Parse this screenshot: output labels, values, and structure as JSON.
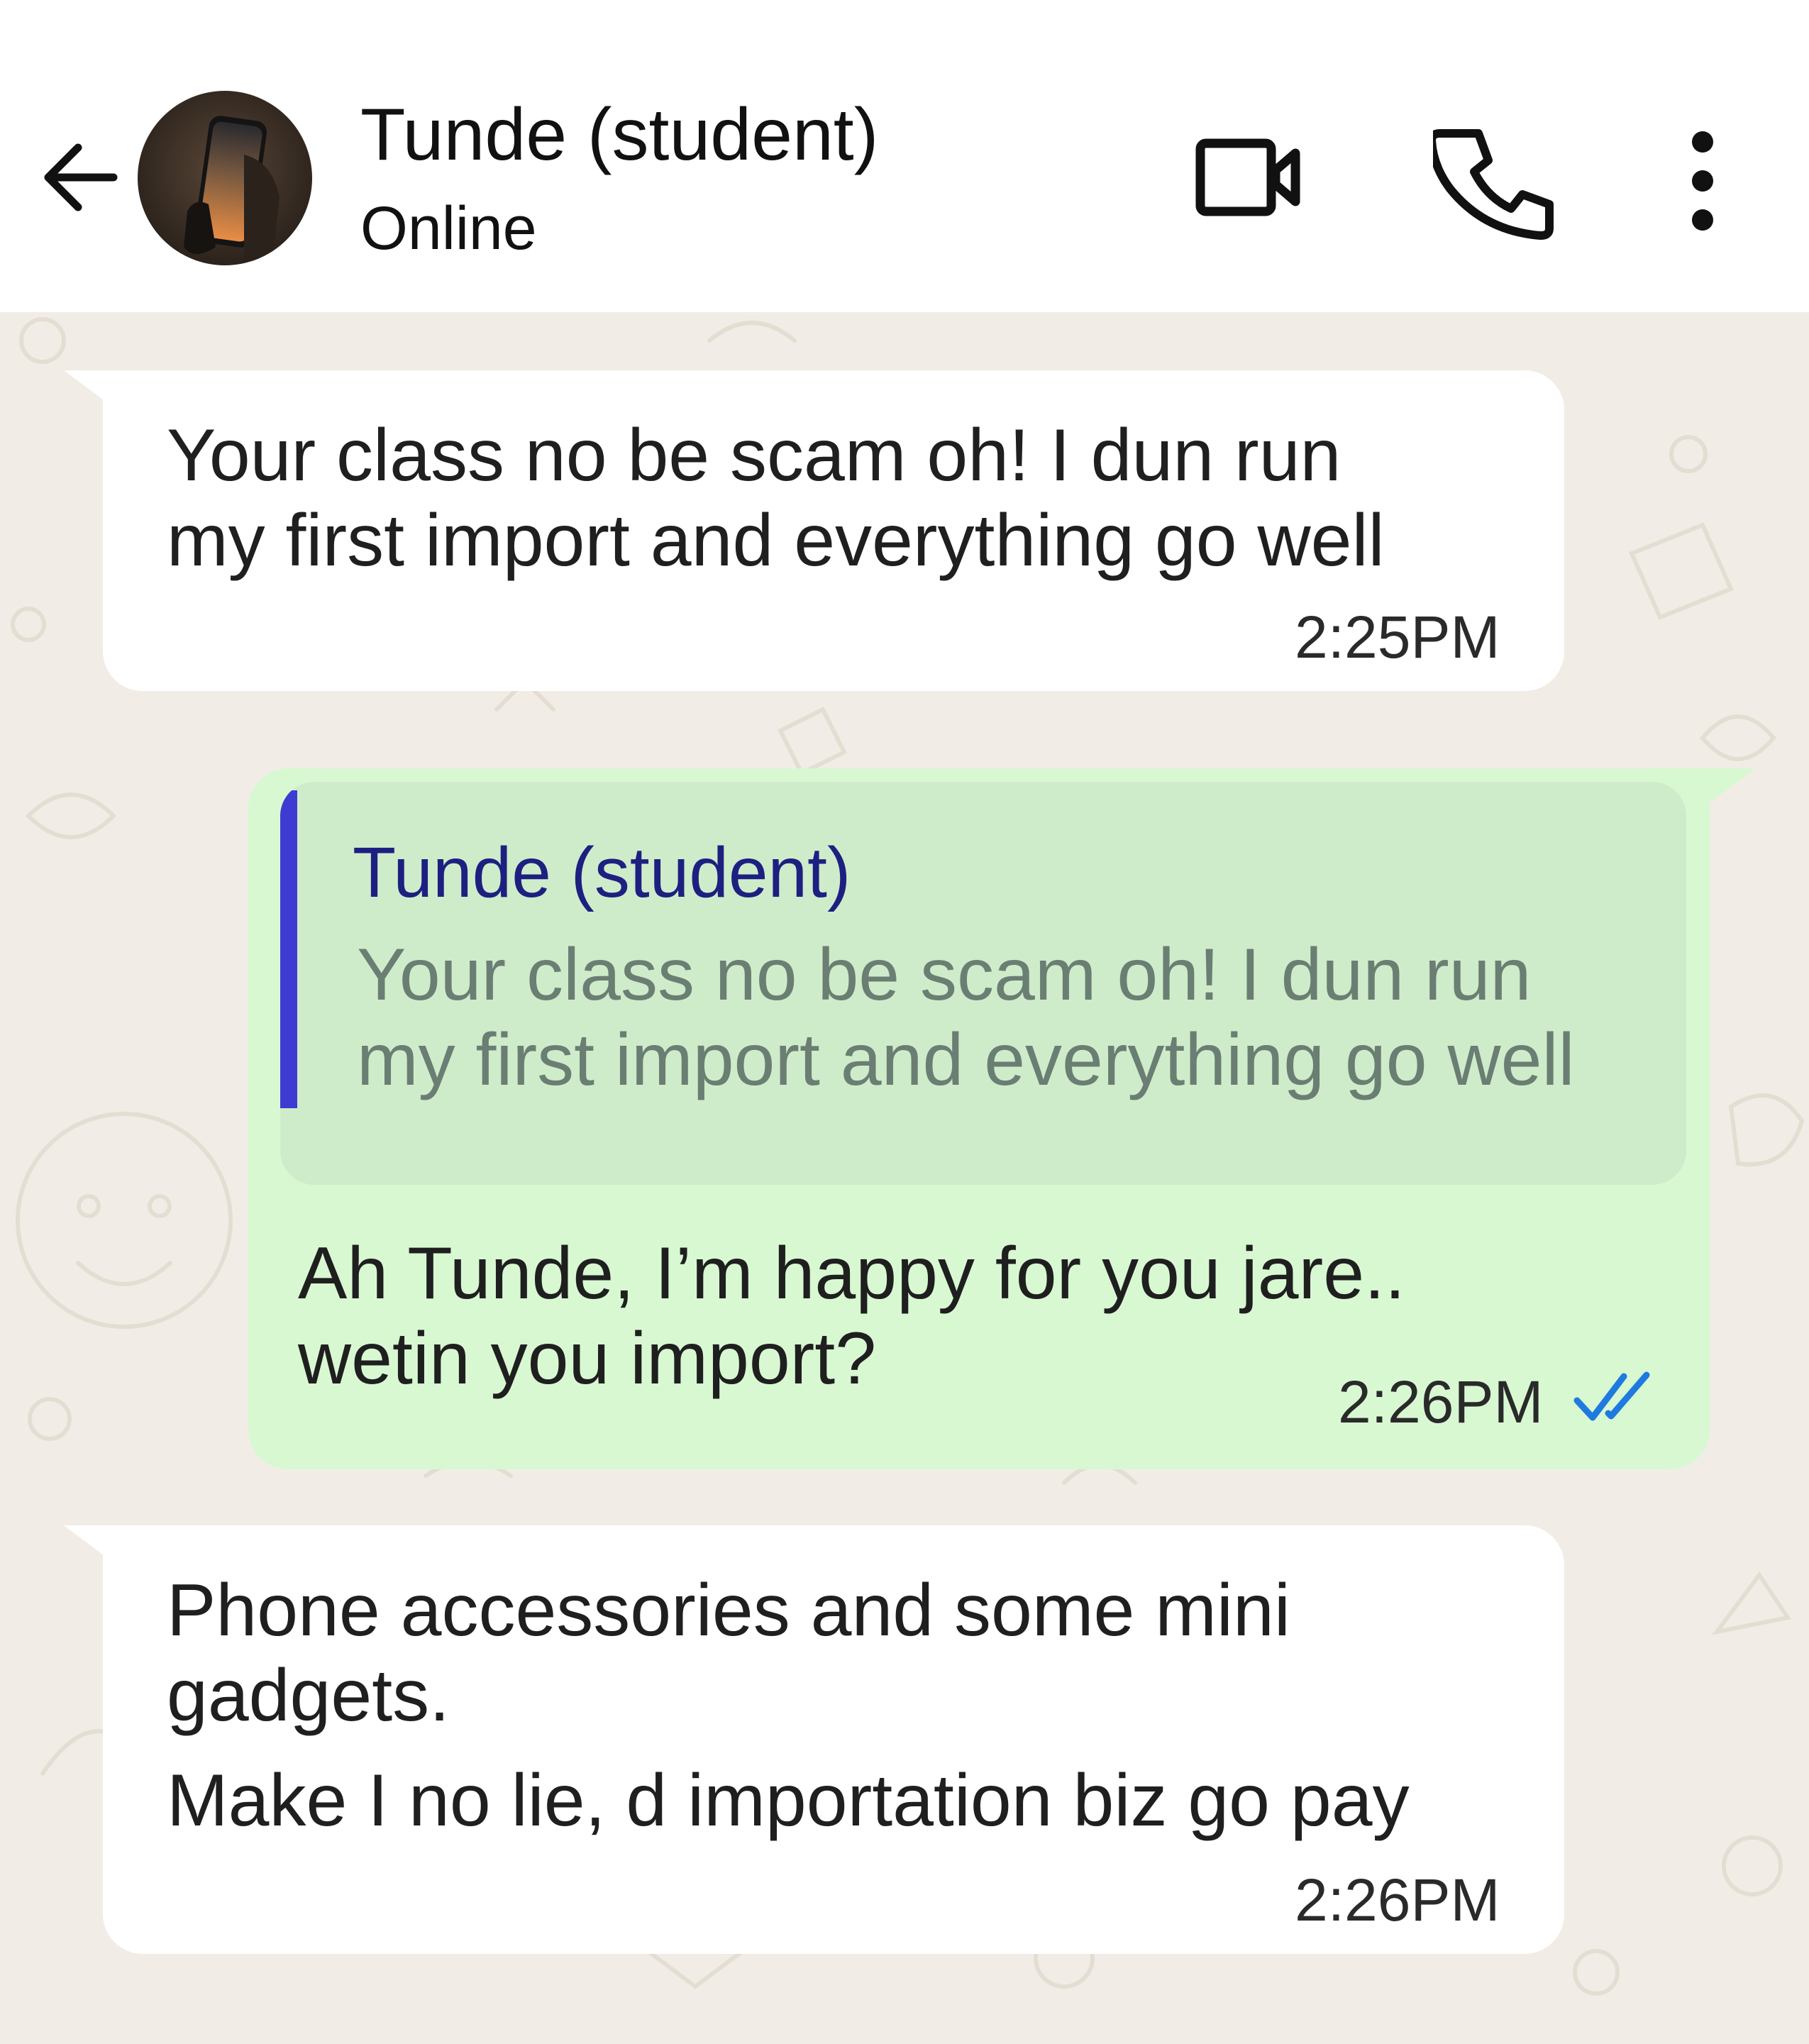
{
  "header": {
    "contact_name": "Tunde (student)",
    "status": "Online",
    "icons": [
      "back-arrow-icon",
      "video-call-icon",
      "phone-icon",
      "more-vert-icon"
    ]
  },
  "messages": [
    {
      "direction": "incoming",
      "lines": [
        "Your class no be scam oh! I dun run",
        "my first import and everything go well"
      ],
      "time": "2:25PM"
    },
    {
      "direction": "outgoing",
      "quote": {
        "name": "Tunde (student)",
        "lines": [
          "Your class no be scam oh! I dun run",
          "my first import and everything go well"
        ]
      },
      "lines": [
        "Ah Tunde, I’m happy for you jare..",
        "wetin you import?"
      ],
      "time": "2:26PM",
      "status_icon": "double-check-read-icon"
    },
    {
      "direction": "incoming",
      "lines": [
        "Phone accessories and some mini",
        "gadgets.",
        "Make I no lie, d importation biz go pay"
      ],
      "time": "2:26PM"
    }
  ],
  "colors": {
    "header_bg": "#ffffff",
    "chat_bg": "#f1ede6",
    "incoming_bubble": "#ffffff",
    "outgoing_bubble": "#d8f8d2",
    "quote_bg": "#cfecca",
    "quote_bar": "#3e3bd2",
    "quote_name": "#1d2080",
    "read_ticks": "#1f7ae0"
  }
}
